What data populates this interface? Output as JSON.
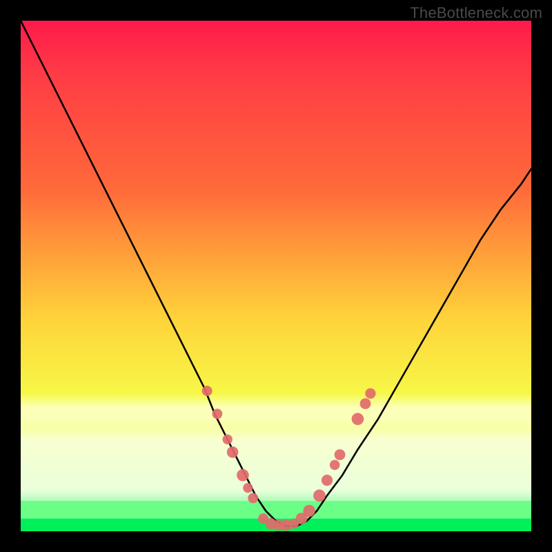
{
  "watermark": "TheBottleneck.com",
  "colors": {
    "frame": "#000000",
    "curve_stroke": "#000000",
    "dot_fill": "#e26a6a",
    "dot_stroke": "#c24f4f",
    "green_band": "#00f05a",
    "green_band_light": "#6bff88",
    "cream_band": "#fbffb8",
    "gradient_top": "#ff1a4b",
    "gradient_mid_upper": "#ff6a3a",
    "gradient_mid": "#ffd23a",
    "gradient_lower": "#f5ff4a"
  },
  "chart_data": {
    "type": "line",
    "title": "",
    "xlabel": "",
    "ylabel": "",
    "xlim": [
      0,
      100
    ],
    "ylim": [
      0,
      100
    ],
    "series": [
      {
        "name": "bottleneck-curve",
        "x": [
          0,
          3,
          6,
          9,
          12,
          15,
          18,
          21,
          24,
          27,
          30,
          33,
          36,
          38,
          40,
          42,
          44,
          46,
          48,
          50,
          52,
          54,
          56,
          58,
          60,
          63,
          66,
          70,
          74,
          78,
          82,
          86,
          90,
          94,
          98,
          100
        ],
        "y": [
          100,
          94,
          88,
          82,
          76,
          70,
          64,
          58,
          52,
          46,
          40,
          34,
          28,
          23,
          19,
          15,
          11,
          7,
          4,
          2,
          1,
          1,
          2,
          4,
          7,
          11,
          16,
          22,
          29,
          36,
          43,
          50,
          57,
          63,
          68,
          71
        ]
      }
    ],
    "dots_left": [
      {
        "x": 36.5,
        "y": 27.5
      },
      {
        "x": 38.5,
        "y": 23.0
      },
      {
        "x": 40.5,
        "y": 18.0
      },
      {
        "x": 41.5,
        "y": 15.5
      },
      {
        "x": 43.5,
        "y": 11.0
      },
      {
        "x": 44.5,
        "y": 8.5
      },
      {
        "x": 45.5,
        "y": 6.5
      }
    ],
    "dots_bottom": [
      {
        "x": 47.5,
        "y": 2.5
      },
      {
        "x": 49.0,
        "y": 1.5
      },
      {
        "x": 50.5,
        "y": 1.2
      },
      {
        "x": 52.0,
        "y": 1.2
      },
      {
        "x": 53.5,
        "y": 1.5
      },
      {
        "x": 55.0,
        "y": 2.5
      },
      {
        "x": 56.5,
        "y": 4.0
      }
    ],
    "dots_right": [
      {
        "x": 58.5,
        "y": 7.0
      },
      {
        "x": 60.0,
        "y": 10.0
      },
      {
        "x": 61.5,
        "y": 13.0
      },
      {
        "x": 62.5,
        "y": 15.0
      },
      {
        "x": 66.0,
        "y": 22.0
      },
      {
        "x": 67.5,
        "y": 25.0
      },
      {
        "x": 68.5,
        "y": 27.0
      }
    ],
    "bands": [
      {
        "name": "cream",
        "y0": 19,
        "y1": 27
      },
      {
        "name": "green-light",
        "y0": 2.5,
        "y1": 6
      },
      {
        "name": "green",
        "y0": 0,
        "y1": 2.5
      }
    ]
  }
}
